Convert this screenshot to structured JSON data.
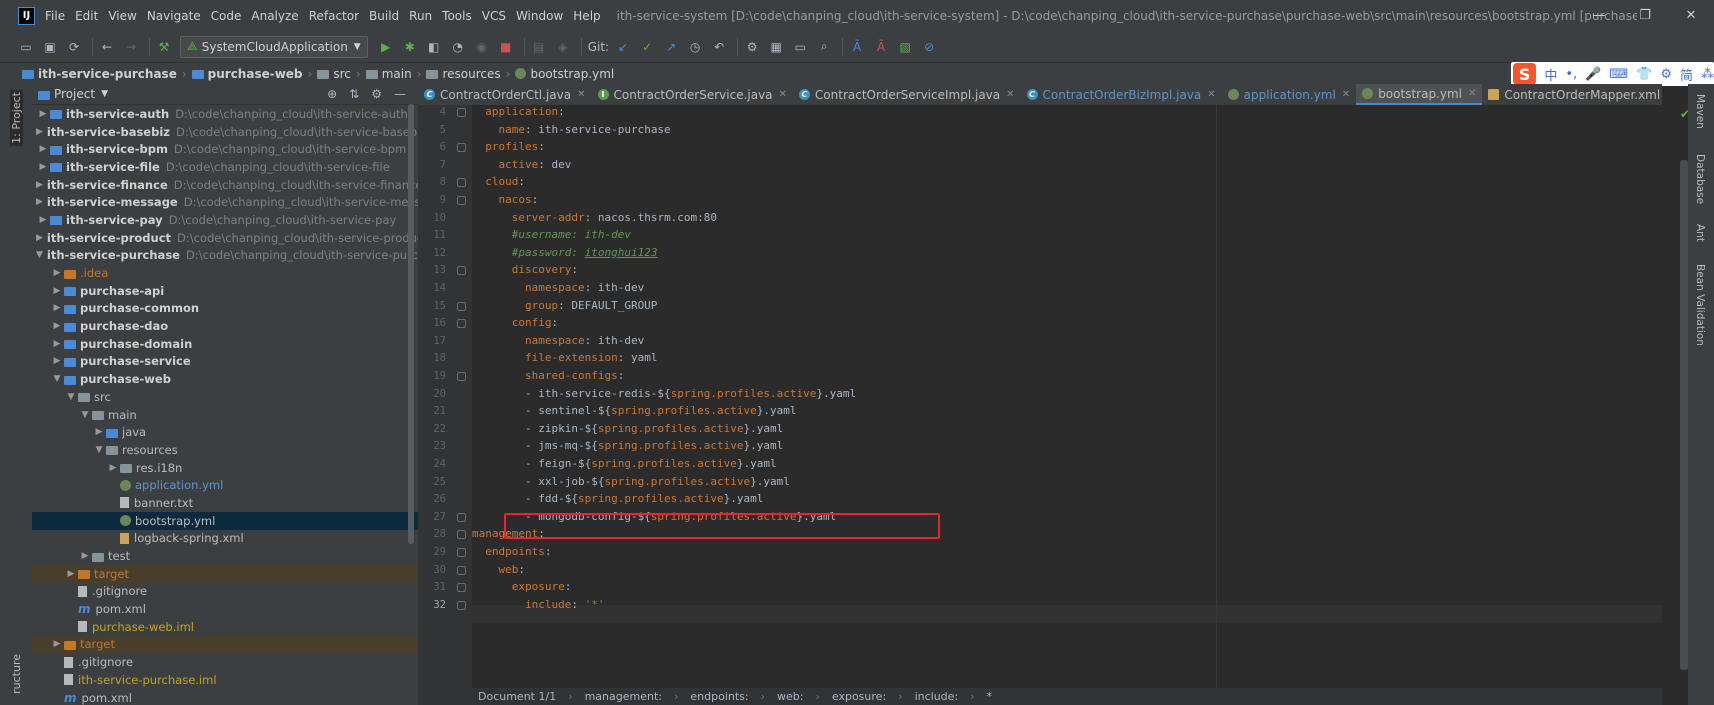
{
  "window": {
    "title": "ith-service-system [D:\\code\\chanping_cloud\\ith-service-system] - D:\\code\\chanping_cloud\\ith-service-purchase\\purchase-web\\src\\main\\resources\\bootstrap.yml [purchase-web] - IntelliJ IDEA",
    "logo": "IJ",
    "minimize": "—",
    "maximize": "❐",
    "close": "✕"
  },
  "menu": [
    "File",
    "Edit",
    "View",
    "Navigate",
    "Code",
    "Analyze",
    "Refactor",
    "Build",
    "Run",
    "Tools",
    "VCS",
    "Window",
    "Help"
  ],
  "toolbar": {
    "run_config": "SystemCloudApplication",
    "git_label": "Git:"
  },
  "breadcrumb": [
    "ith-service-purchase",
    "purchase-web",
    "src",
    "main",
    "resources",
    "bootstrap.yml"
  ],
  "left_strip": {
    "project_tab": "1: Project",
    "structure_tab": "ructure"
  },
  "project_panel": {
    "title": "Project",
    "tree": [
      {
        "name": "ith-service-auth",
        "path": "D:\\code\\chanping_cloud\\ith-service-auth",
        "indent": 0,
        "arrow": "▶",
        "type": "module"
      },
      {
        "name": "ith-service-basebiz",
        "path": "D:\\code\\chanping_cloud\\ith-service-basebiz",
        "indent": 0,
        "arrow": "▶",
        "type": "module"
      },
      {
        "name": "ith-service-bpm",
        "path": "D:\\code\\chanping_cloud\\ith-service-bpm",
        "indent": 0,
        "arrow": "▶",
        "type": "module"
      },
      {
        "name": "ith-service-file",
        "path": "D:\\code\\chanping_cloud\\ith-service-file",
        "indent": 0,
        "arrow": "▶",
        "type": "module"
      },
      {
        "name": "ith-service-finance",
        "path": "D:\\code\\chanping_cloud\\ith-service-finance",
        "indent": 0,
        "arrow": "▶",
        "type": "module"
      },
      {
        "name": "ith-service-message",
        "path": "D:\\code\\chanping_cloud\\ith-service-messag",
        "indent": 0,
        "arrow": "▶",
        "type": "module"
      },
      {
        "name": "ith-service-pay",
        "path": "D:\\code\\chanping_cloud\\ith-service-pay",
        "indent": 0,
        "arrow": "▶",
        "type": "module"
      },
      {
        "name": "ith-service-product",
        "path": "D:\\code\\chanping_cloud\\ith-service-product",
        "indent": 0,
        "arrow": "▶",
        "type": "module"
      },
      {
        "name": "ith-service-purchase",
        "path": "D:\\code\\chanping_cloud\\ith-service-purchas",
        "indent": 0,
        "arrow": "▼",
        "type": "module"
      },
      {
        "name": ".idea",
        "indent": 1,
        "arrow": "▶",
        "type": "folder-orange-text"
      },
      {
        "name": "purchase-api",
        "indent": 1,
        "arrow": "▶",
        "type": "module"
      },
      {
        "name": "purchase-common",
        "indent": 1,
        "arrow": "▶",
        "type": "module"
      },
      {
        "name": "purchase-dao",
        "indent": 1,
        "arrow": "▶",
        "type": "module"
      },
      {
        "name": "purchase-domain",
        "indent": 1,
        "arrow": "▶",
        "type": "module"
      },
      {
        "name": "purchase-service",
        "indent": 1,
        "arrow": "▶",
        "type": "module"
      },
      {
        "name": "purchase-web",
        "indent": 1,
        "arrow": "▼",
        "type": "module"
      },
      {
        "name": "src",
        "indent": 2,
        "arrow": "▼",
        "type": "folder"
      },
      {
        "name": "main",
        "indent": 3,
        "arrow": "▼",
        "type": "folder"
      },
      {
        "name": "java",
        "indent": 4,
        "arrow": "▶",
        "type": "folder-blue"
      },
      {
        "name": "resources",
        "indent": 4,
        "arrow": "▼",
        "type": "folder"
      },
      {
        "name": "res.i18n",
        "indent": 5,
        "arrow": "▶",
        "type": "folder"
      },
      {
        "name": "application.yml",
        "indent": 5,
        "arrow": "",
        "type": "yml-blue"
      },
      {
        "name": "banner.txt",
        "indent": 5,
        "arrow": "",
        "type": "txt"
      },
      {
        "name": "bootstrap.yml",
        "indent": 5,
        "arrow": "",
        "type": "yml",
        "selected": true
      },
      {
        "name": "logback-spring.xml",
        "indent": 5,
        "arrow": "",
        "type": "xml"
      },
      {
        "name": "test",
        "indent": 3,
        "arrow": "▶",
        "type": "folder"
      },
      {
        "name": "target",
        "indent": 2,
        "arrow": "▶",
        "type": "folder-orange",
        "excluded": true
      },
      {
        "name": ".gitignore",
        "indent": 2,
        "arrow": "",
        "type": "txt"
      },
      {
        "name": "pom.xml",
        "indent": 2,
        "arrow": "",
        "type": "m"
      },
      {
        "name": "purchase-web.iml",
        "indent": 2,
        "arrow": "",
        "type": "iml"
      },
      {
        "name": "target",
        "indent": 1,
        "arrow": "▶",
        "type": "folder-orange",
        "excluded": true
      },
      {
        "name": ".gitignore",
        "indent": 1,
        "arrow": "",
        "type": "txt"
      },
      {
        "name": "ith-service-purchase.iml",
        "indent": 1,
        "arrow": "",
        "type": "iml"
      },
      {
        "name": "pom.xml",
        "indent": 1,
        "arrow": "",
        "type": "m"
      }
    ]
  },
  "tabs": [
    {
      "label": "ContractOrderCtl.java",
      "icon": "c",
      "blue": false
    },
    {
      "label": "ContractOrderService.java",
      "icon": "i",
      "blue": false
    },
    {
      "label": "ContractOrderServiceImpl.java",
      "icon": "c",
      "blue": false
    },
    {
      "label": "ContractOrderBizImpl.java",
      "icon": "c",
      "blue": true
    },
    {
      "label": "application.yml",
      "icon": "y",
      "blue": true
    },
    {
      "label": "bootstrap.yml",
      "icon": "y",
      "blue": false,
      "active": true
    },
    {
      "label": "ContractOrderMapper.xml",
      "icon": "x",
      "blue": false
    }
  ],
  "code": [
    {
      "n": "4",
      "t": [
        [
          "k",
          "  application"
        ],
        [
          "p",
          ":"
        ]
      ]
    },
    {
      "n": "5",
      "t": [
        [
          "k",
          "    name"
        ],
        [
          "p",
          ": ith-service-purchase"
        ]
      ]
    },
    {
      "n": "6",
      "t": [
        [
          "k",
          "  profiles"
        ],
        [
          "p",
          ":"
        ]
      ]
    },
    {
      "n": "7",
      "t": [
        [
          "k",
          "    active"
        ],
        [
          "p",
          ": dev"
        ]
      ]
    },
    {
      "n": "8",
      "t": [
        [
          "k",
          "  cloud"
        ],
        [
          "p",
          ":"
        ]
      ]
    },
    {
      "n": "9",
      "t": [
        [
          "k",
          "    nacos"
        ],
        [
          "p",
          ":"
        ]
      ]
    },
    {
      "n": "10",
      "t": [
        [
          "k",
          "      server-addr"
        ],
        [
          "p",
          ": nacos.thsrm.com:80"
        ]
      ]
    },
    {
      "n": "11",
      "t": [
        [
          "c",
          "      #username: ith-dev"
        ]
      ]
    },
    {
      "n": "12",
      "t": [
        [
          "c",
          "      #password: "
        ],
        [
          "u",
          "itonghui123"
        ]
      ]
    },
    {
      "n": "13",
      "t": [
        [
          "k",
          "      discovery"
        ],
        [
          "p",
          ":"
        ]
      ]
    },
    {
      "n": "14",
      "t": [
        [
          "k",
          "        namespace"
        ],
        [
          "p",
          ": ith-dev"
        ]
      ]
    },
    {
      "n": "15",
      "t": [
        [
          "k",
          "        group"
        ],
        [
          "p",
          ": DEFAULT_GROUP"
        ]
      ]
    },
    {
      "n": "16",
      "t": [
        [
          "k",
          "      config"
        ],
        [
          "p",
          ":"
        ]
      ]
    },
    {
      "n": "17",
      "t": [
        [
          "k",
          "        namespace"
        ],
        [
          "p",
          ": ith-dev"
        ]
      ]
    },
    {
      "n": "18",
      "t": [
        [
          "k",
          "        file-extension"
        ],
        [
          "p",
          ": yaml"
        ]
      ]
    },
    {
      "n": "19",
      "t": [
        [
          "k",
          "        shared-configs"
        ],
        [
          "p",
          ":"
        ]
      ]
    },
    {
      "n": "20",
      "t": [
        [
          "p",
          "        - ith-service-redis-${"
        ],
        [
          "k",
          "spring.profiles.active"
        ],
        [
          "p",
          "}.yaml"
        ]
      ]
    },
    {
      "n": "21",
      "t": [
        [
          "p",
          "        - sentinel-${"
        ],
        [
          "k",
          "spring.profiles.active"
        ],
        [
          "p",
          "}.yaml"
        ]
      ]
    },
    {
      "n": "22",
      "t": [
        [
          "p",
          "        - zipkin-${"
        ],
        [
          "k",
          "spring.profiles.active"
        ],
        [
          "p",
          "}.yaml"
        ]
      ]
    },
    {
      "n": "23",
      "t": [
        [
          "p",
          "        - jms-mq-${"
        ],
        [
          "k",
          "spring.profiles.active"
        ],
        [
          "p",
          "}.yaml"
        ]
      ]
    },
    {
      "n": "24",
      "t": [
        [
          "p",
          "        - feign-${"
        ],
        [
          "k",
          "spring.profiles.active"
        ],
        [
          "p",
          "}.yaml"
        ]
      ]
    },
    {
      "n": "25",
      "t": [
        [
          "p",
          "        - xxl-job-${"
        ],
        [
          "k",
          "spring.profiles.active"
        ],
        [
          "p",
          "}.yaml"
        ]
      ]
    },
    {
      "n": "26",
      "t": [
        [
          "p",
          "        - fdd-${"
        ],
        [
          "k",
          "spring.profiles.active"
        ],
        [
          "p",
          "}.yaml"
        ]
      ]
    },
    {
      "n": "27",
      "t": [
        [
          "p",
          "        - mongodb-config-${"
        ],
        [
          "k",
          "spring.profiles.active"
        ],
        [
          "p",
          "}.yaml"
        ]
      ]
    },
    {
      "n": "28",
      "t": [
        [
          "k",
          "management"
        ],
        [
          "p",
          ":"
        ]
      ]
    },
    {
      "n": "29",
      "t": [
        [
          "k",
          "  endpoints"
        ],
        [
          "p",
          ":"
        ]
      ]
    },
    {
      "n": "30",
      "t": [
        [
          "k",
          "    web"
        ],
        [
          "p",
          ":"
        ]
      ]
    },
    {
      "n": "31",
      "t": [
        [
          "k",
          "      exposure"
        ],
        [
          "p",
          ":"
        ]
      ]
    },
    {
      "n": "32",
      "t": [
        [
          "k",
          "        include"
        ],
        [
          "p",
          ": "
        ],
        [
          "s",
          "'*'"
        ]
      ]
    }
  ],
  "editor_breadcrumb": [
    "Document 1/1",
    "management:",
    "endpoints:",
    "web:",
    "exposure:",
    "include:",
    "*"
  ],
  "right_strip": [
    "Maven",
    "Database",
    "Ant",
    "Bean Validation"
  ],
  "ime": {
    "logo": "S",
    "items": [
      "中",
      "•,",
      "🎤",
      "⌨",
      "👕",
      "⚙",
      "简",
      "⁂"
    ]
  }
}
